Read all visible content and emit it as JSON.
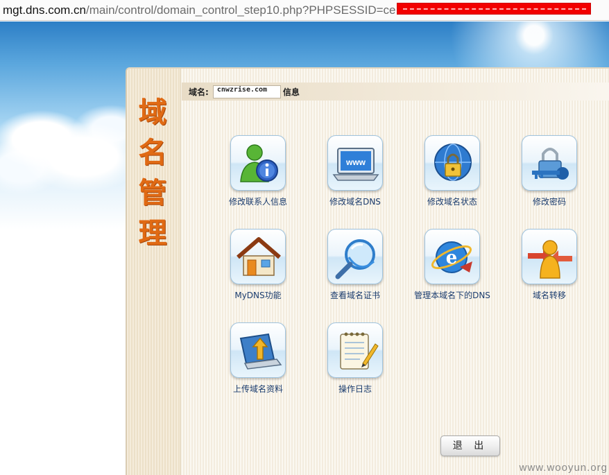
{
  "url_bar": {
    "host": "mgt.dns.com.cn",
    "path": "/main/control/domain_control_step10.php?PHPSESSID=ce"
  },
  "panel": {
    "title": "域名管理",
    "domain_label": "域名:",
    "domain_value": "cnwzrise.com",
    "info_label": "信息"
  },
  "tiles": [
    {
      "label": "修改联系人信息",
      "icon": "contact-info-icon"
    },
    {
      "label": "修改域名DNS",
      "icon": "monitor-www-icon"
    },
    {
      "label": "修改域名状态",
      "icon": "globe-lock-icon"
    },
    {
      "label": "修改密码",
      "icon": "key-lock-icon"
    },
    {
      "label": "MyDNS功能",
      "icon": "house-icon"
    },
    {
      "label": "查看域名证书",
      "icon": "magnifier-icon"
    },
    {
      "label": "管理本域名下的DNS",
      "icon": "ie-globe-icon"
    },
    {
      "label": "域名转移",
      "icon": "user-transfer-icon"
    },
    {
      "label": "上传域名资料",
      "icon": "laptop-upload-icon"
    },
    {
      "label": "操作日志",
      "icon": "notepad-icon"
    }
  ],
  "logout_label": "退 出",
  "watermark": "www.wooyun.org"
}
